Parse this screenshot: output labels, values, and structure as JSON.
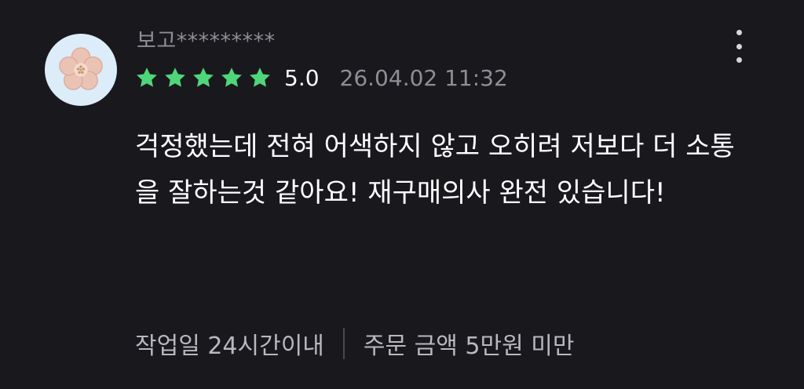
{
  "review": {
    "username": "보고*********",
    "avatar_icon": "flower-icon",
    "rating": 5,
    "rating_text": "5.0",
    "date": "26.04.02 11:32",
    "text": "걱정했는데 전혀 어색하지 않고 오히려 저보다 더 소통을 잘하는것 같아요! 재구매의사 완전 있습니다!",
    "tags": [
      "작업일 24시간이내",
      "주문 금액 5만원 미만"
    ],
    "more_icon": "more-vertical-icon"
  },
  "colors": {
    "background": "#19181d",
    "star": "#4fd67a",
    "muted_text": "#8f8e94",
    "avatar_bg": "#dcecf8"
  }
}
